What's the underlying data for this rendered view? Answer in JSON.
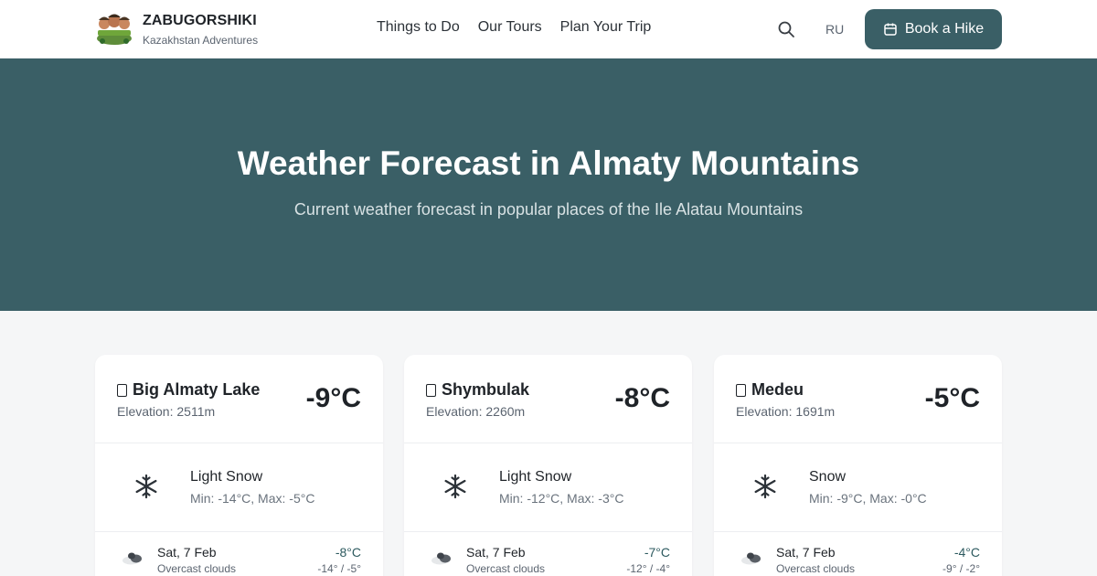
{
  "header": {
    "brand_name": "ZABUGORSHIKI",
    "brand_sub": "Kazakhstan Adventures",
    "nav": [
      "Things to Do",
      "Our Tours",
      "Plan Your Trip"
    ],
    "lang": "RU",
    "book_label": "Book a Hike",
    "search_icon": "search-icon",
    "calendar_icon": "calendar-icon"
  },
  "hero": {
    "title": "Weather Forecast in Almaty Mountains",
    "subtitle": "Current weather forecast in popular places of the Ile Alatau Mountains"
  },
  "colors": {
    "accent": "#3a5f66",
    "hero_bg": "#3a5f66",
    "page_bg": "#f5f6f7"
  },
  "cards": [
    {
      "name": "Big Almaty Lake",
      "elevation": "Elevation: 2511m",
      "temp": "-9°C",
      "condition": "Light Snow",
      "range": "Min: -14°C, Max: -5°C",
      "day": {
        "date": "Sat, 7 Feb",
        "desc": "Overcast clouds",
        "temp": "-8°C",
        "range": "-14° / -5°"
      }
    },
    {
      "name": "Shymbulak",
      "elevation": "Elevation: 2260m",
      "temp": "-8°C",
      "condition": "Light Snow",
      "range": "Min: -12°C, Max: -3°C",
      "day": {
        "date": "Sat, 7 Feb",
        "desc": "Overcast clouds",
        "temp": "-7°C",
        "range": "-12° / -4°"
      }
    },
    {
      "name": "Medeu",
      "elevation": "Elevation: 1691m",
      "temp": "-5°C",
      "condition": "Snow",
      "range": "Min: -9°C, Max: -0°C",
      "day": {
        "date": "Sat, 7 Feb",
        "desc": "Overcast clouds",
        "temp": "-4°C",
        "range": "-9° / -2°"
      }
    }
  ]
}
